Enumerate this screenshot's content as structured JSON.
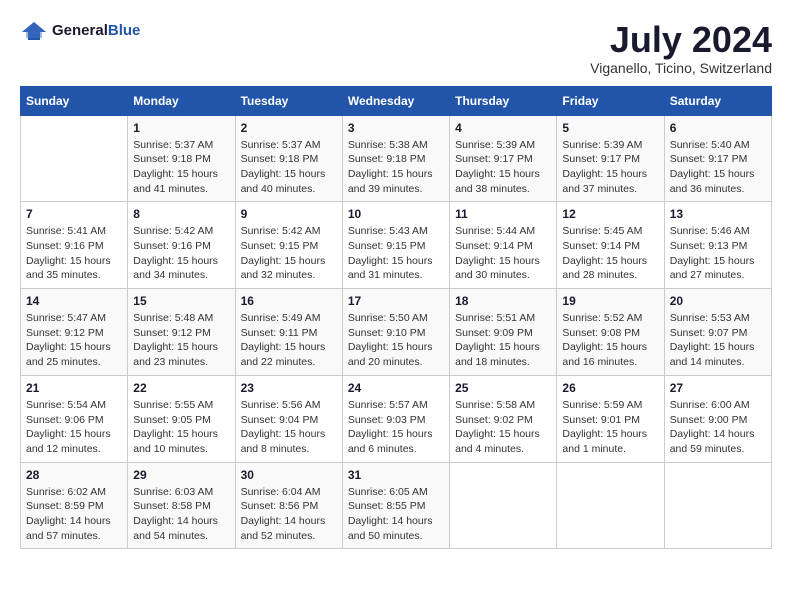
{
  "header": {
    "logo_general": "General",
    "logo_blue": "Blue",
    "title": "July 2024",
    "location": "Viganello, Ticino, Switzerland"
  },
  "calendar": {
    "days_of_week": [
      "Sunday",
      "Monday",
      "Tuesday",
      "Wednesday",
      "Thursday",
      "Friday",
      "Saturday"
    ],
    "weeks": [
      [
        {
          "day": "",
          "info": ""
        },
        {
          "day": "1",
          "info": "Sunrise: 5:37 AM\nSunset: 9:18 PM\nDaylight: 15 hours\nand 41 minutes."
        },
        {
          "day": "2",
          "info": "Sunrise: 5:37 AM\nSunset: 9:18 PM\nDaylight: 15 hours\nand 40 minutes."
        },
        {
          "day": "3",
          "info": "Sunrise: 5:38 AM\nSunset: 9:18 PM\nDaylight: 15 hours\nand 39 minutes."
        },
        {
          "day": "4",
          "info": "Sunrise: 5:39 AM\nSunset: 9:17 PM\nDaylight: 15 hours\nand 38 minutes."
        },
        {
          "day": "5",
          "info": "Sunrise: 5:39 AM\nSunset: 9:17 PM\nDaylight: 15 hours\nand 37 minutes."
        },
        {
          "day": "6",
          "info": "Sunrise: 5:40 AM\nSunset: 9:17 PM\nDaylight: 15 hours\nand 36 minutes."
        }
      ],
      [
        {
          "day": "7",
          "info": "Sunrise: 5:41 AM\nSunset: 9:16 PM\nDaylight: 15 hours\nand 35 minutes."
        },
        {
          "day": "8",
          "info": "Sunrise: 5:42 AM\nSunset: 9:16 PM\nDaylight: 15 hours\nand 34 minutes."
        },
        {
          "day": "9",
          "info": "Sunrise: 5:42 AM\nSunset: 9:15 PM\nDaylight: 15 hours\nand 32 minutes."
        },
        {
          "day": "10",
          "info": "Sunrise: 5:43 AM\nSunset: 9:15 PM\nDaylight: 15 hours\nand 31 minutes."
        },
        {
          "day": "11",
          "info": "Sunrise: 5:44 AM\nSunset: 9:14 PM\nDaylight: 15 hours\nand 30 minutes."
        },
        {
          "day": "12",
          "info": "Sunrise: 5:45 AM\nSunset: 9:14 PM\nDaylight: 15 hours\nand 28 minutes."
        },
        {
          "day": "13",
          "info": "Sunrise: 5:46 AM\nSunset: 9:13 PM\nDaylight: 15 hours\nand 27 minutes."
        }
      ],
      [
        {
          "day": "14",
          "info": "Sunrise: 5:47 AM\nSunset: 9:12 PM\nDaylight: 15 hours\nand 25 minutes."
        },
        {
          "day": "15",
          "info": "Sunrise: 5:48 AM\nSunset: 9:12 PM\nDaylight: 15 hours\nand 23 minutes."
        },
        {
          "day": "16",
          "info": "Sunrise: 5:49 AM\nSunset: 9:11 PM\nDaylight: 15 hours\nand 22 minutes."
        },
        {
          "day": "17",
          "info": "Sunrise: 5:50 AM\nSunset: 9:10 PM\nDaylight: 15 hours\nand 20 minutes."
        },
        {
          "day": "18",
          "info": "Sunrise: 5:51 AM\nSunset: 9:09 PM\nDaylight: 15 hours\nand 18 minutes."
        },
        {
          "day": "19",
          "info": "Sunrise: 5:52 AM\nSunset: 9:08 PM\nDaylight: 15 hours\nand 16 minutes."
        },
        {
          "day": "20",
          "info": "Sunrise: 5:53 AM\nSunset: 9:07 PM\nDaylight: 15 hours\nand 14 minutes."
        }
      ],
      [
        {
          "day": "21",
          "info": "Sunrise: 5:54 AM\nSunset: 9:06 PM\nDaylight: 15 hours\nand 12 minutes."
        },
        {
          "day": "22",
          "info": "Sunrise: 5:55 AM\nSunset: 9:05 PM\nDaylight: 15 hours\nand 10 minutes."
        },
        {
          "day": "23",
          "info": "Sunrise: 5:56 AM\nSunset: 9:04 PM\nDaylight: 15 hours\nand 8 minutes."
        },
        {
          "day": "24",
          "info": "Sunrise: 5:57 AM\nSunset: 9:03 PM\nDaylight: 15 hours\nand 6 minutes."
        },
        {
          "day": "25",
          "info": "Sunrise: 5:58 AM\nSunset: 9:02 PM\nDaylight: 15 hours\nand 4 minutes."
        },
        {
          "day": "26",
          "info": "Sunrise: 5:59 AM\nSunset: 9:01 PM\nDaylight: 15 hours\nand 1 minute."
        },
        {
          "day": "27",
          "info": "Sunrise: 6:00 AM\nSunset: 9:00 PM\nDaylight: 14 hours\nand 59 minutes."
        }
      ],
      [
        {
          "day": "28",
          "info": "Sunrise: 6:02 AM\nSunset: 8:59 PM\nDaylight: 14 hours\nand 57 minutes."
        },
        {
          "day": "29",
          "info": "Sunrise: 6:03 AM\nSunset: 8:58 PM\nDaylight: 14 hours\nand 54 minutes."
        },
        {
          "day": "30",
          "info": "Sunrise: 6:04 AM\nSunset: 8:56 PM\nDaylight: 14 hours\nand 52 minutes."
        },
        {
          "day": "31",
          "info": "Sunrise: 6:05 AM\nSunset: 8:55 PM\nDaylight: 14 hours\nand 50 minutes."
        },
        {
          "day": "",
          "info": ""
        },
        {
          "day": "",
          "info": ""
        },
        {
          "day": "",
          "info": ""
        }
      ]
    ]
  }
}
